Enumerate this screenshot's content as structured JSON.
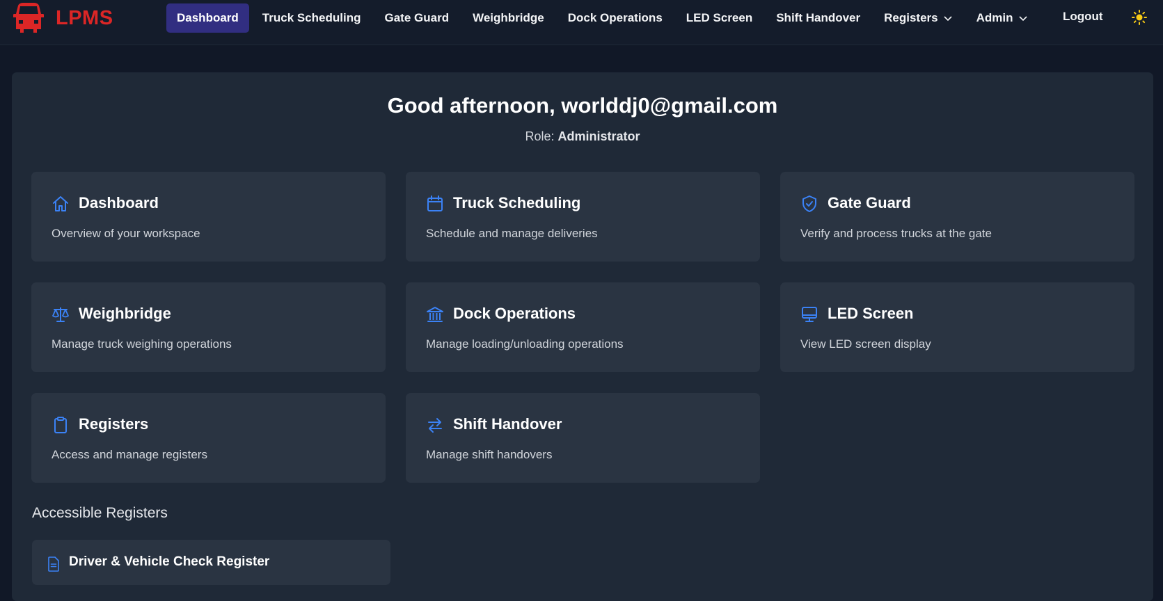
{
  "app": {
    "name": "LPMS",
    "logo_icon": "truck-icon",
    "brand_color": "#dc2626"
  },
  "nav": {
    "items": [
      {
        "label": "Dashboard",
        "active": true
      },
      {
        "label": "Truck Scheduling"
      },
      {
        "label": "Gate Guard"
      },
      {
        "label": "Weighbridge"
      },
      {
        "label": "Dock Operations"
      },
      {
        "label": "LED Screen"
      },
      {
        "label": "Shift Handover"
      },
      {
        "label": "Registers",
        "dropdown": true
      },
      {
        "label": "Admin",
        "dropdown": true
      }
    ],
    "logout": "Logout",
    "theme_icon": "sun-icon"
  },
  "greeting": {
    "text": "Good afternoon, worlddj0@gmail.com",
    "role_label": "Role:",
    "role_value": "Administrator"
  },
  "cards": [
    {
      "title": "Dashboard",
      "description": "Overview of your workspace",
      "icon": "home-icon"
    },
    {
      "title": "Truck Scheduling",
      "description": "Schedule and manage deliveries",
      "icon": "calendar-icon"
    },
    {
      "title": "Gate Guard",
      "description": "Verify and process trucks at the gate",
      "icon": "shield-check-icon"
    },
    {
      "title": "Weighbridge",
      "description": "Manage truck weighing operations",
      "icon": "scale-icon"
    },
    {
      "title": "Dock Operations",
      "description": "Manage loading/unloading operations",
      "icon": "building-icon"
    },
    {
      "title": "LED Screen",
      "description": "View LED screen display",
      "icon": "monitor-icon"
    },
    {
      "title": "Registers",
      "description": "Access and manage registers",
      "icon": "clipboard-icon"
    },
    {
      "title": "Shift Handover",
      "description": "Manage shift handovers",
      "icon": "arrows-exchange-icon"
    }
  ],
  "registers_section": {
    "title": "Accessible Registers",
    "items": [
      {
        "label": "Driver & Vehicle Check Register",
        "icon": "document-icon"
      }
    ]
  },
  "colors": {
    "accent": "#3b82f6",
    "active_nav": "#312e81"
  }
}
